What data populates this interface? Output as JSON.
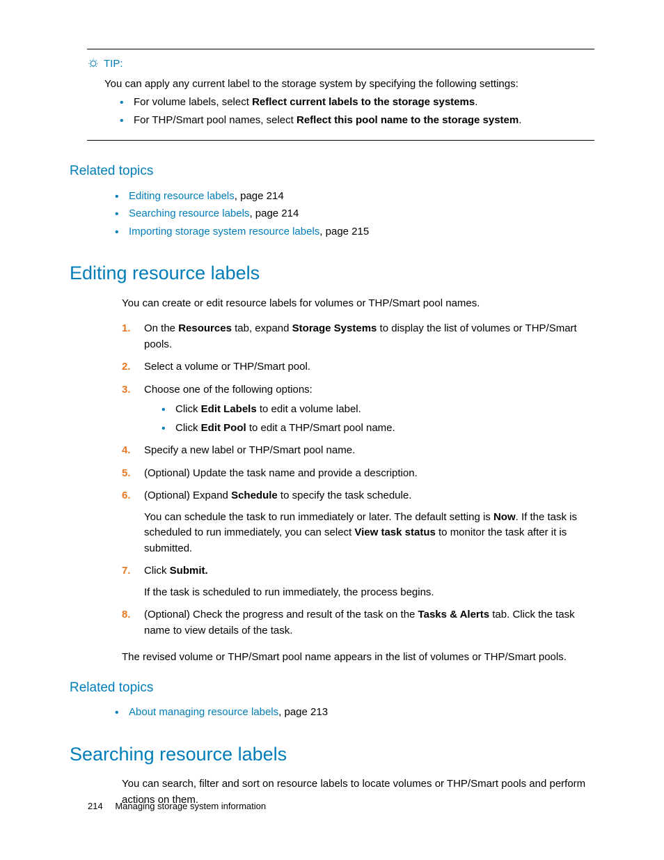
{
  "tip": {
    "label": "TIP:",
    "intro": "You can apply any current label to the storage system by specifying the following settings:",
    "items": [
      {
        "pre": "For volume labels, select ",
        "bold": "Reflect current labels to the storage systems",
        "post": "."
      },
      {
        "pre": "For THP/Smart pool names, select ",
        "bold": "Reflect this pool name to the storage system",
        "post": "."
      }
    ]
  },
  "related1": {
    "heading": "Related topics",
    "items": [
      {
        "link": "Editing resource labels",
        "suffix": ", page 214"
      },
      {
        "link": "Searching resource labels",
        "suffix": ", page 214"
      },
      {
        "link": "Importing storage system resource labels",
        "suffix": ", page 215"
      }
    ]
  },
  "section1": {
    "heading": "Editing resource labels",
    "intro": "You can create or edit resource labels for volumes or THP/Smart pool names.",
    "steps": {
      "s1": {
        "num": "1.",
        "pre": "On the ",
        "b1": "Resources",
        "mid": " tab, expand ",
        "b2": "Storage Systems",
        "post": " to display the list of volumes or THP/Smart pools."
      },
      "s2": {
        "num": "2.",
        "text": "Select a volume or THP/Smart pool."
      },
      "s3": {
        "num": "3.",
        "text": "Choose one of the following options:",
        "sub": [
          {
            "pre": "Click ",
            "bold": "Edit Labels",
            "post": " to edit a volume label."
          },
          {
            "pre": "Click ",
            "bold": "Edit Pool",
            "post": " to edit a THP/Smart pool name."
          }
        ]
      },
      "s4": {
        "num": "4.",
        "text": "Specify a new label or THP/Smart pool name."
      },
      "s5": {
        "num": "5.",
        "text": "(Optional) Update the task name and provide a description."
      },
      "s6": {
        "num": "6.",
        "pre": "(Optional) Expand ",
        "bold": "Schedule",
        "post": " to specify the task schedule.",
        "extraPre": "You can schedule the task to run immediately or later. The default setting is ",
        "extraB1": "Now",
        "extraMid": ". If the task is scheduled to run immediately, you can select ",
        "extraB2": "View task status",
        "extraPost": " to monitor the task after it is submitted."
      },
      "s7": {
        "num": "7.",
        "pre": "Click ",
        "bold": "Submit.",
        "extra": "If the task is scheduled to run immediately, the process begins."
      },
      "s8": {
        "num": "8.",
        "pre": "(Optional) Check the progress and result of the task on the ",
        "bold": "Tasks & Alerts",
        "post": " tab. Click the task name to view details of the task."
      }
    },
    "closing": "The revised volume or THP/Smart pool name appears in the list of volumes or THP/Smart pools."
  },
  "related2": {
    "heading": "Related topics",
    "items": [
      {
        "link": "About managing resource labels",
        "suffix": ", page 213"
      }
    ]
  },
  "section2": {
    "heading": "Searching resource labels",
    "intro": "You can search, filter and sort on resource labels to locate volumes or THP/Smart pools and perform actions on them."
  },
  "footer": {
    "page": "214",
    "title": "Managing storage system information"
  }
}
